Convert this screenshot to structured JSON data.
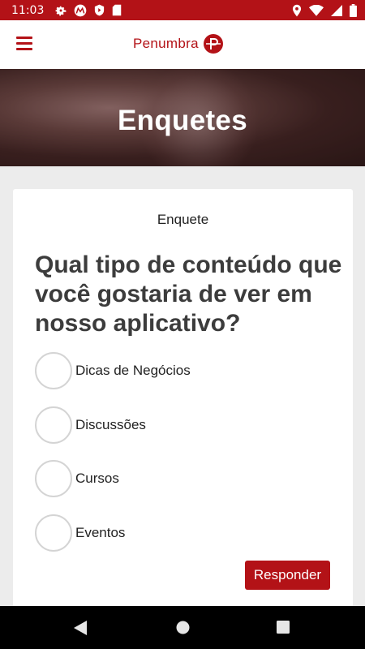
{
  "status_bar": {
    "time": "11:03",
    "icons_left": [
      "settings-gear-icon",
      "motorola-icon",
      "shield-icon",
      "sd-card-icon"
    ],
    "icons_right": [
      "location-icon",
      "wifi-icon",
      "signal-icon",
      "battery-icon"
    ]
  },
  "app_bar": {
    "menu_icon": "hamburger-menu-icon",
    "logo_text": "Penumbra",
    "logo_mark": "P"
  },
  "hero": {
    "title": "Enquetes"
  },
  "poll": {
    "label": "Enquete",
    "question": "Qual tipo de conteúdo que você gostaria de ver em nosso aplicativo?",
    "options": [
      {
        "label": "Dicas de Negócios",
        "selected": false
      },
      {
        "label": "Discussões",
        "selected": false
      },
      {
        "label": "Cursos",
        "selected": false
      },
      {
        "label": "Eventos",
        "selected": false
      }
    ],
    "submit_label": "Responder"
  },
  "colors": {
    "accent": "#b31217",
    "background": "#ececec"
  },
  "nav_bar": {
    "buttons": [
      "back-icon",
      "home-icon",
      "recents-icon"
    ]
  }
}
